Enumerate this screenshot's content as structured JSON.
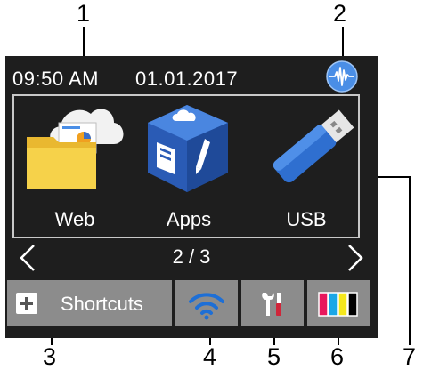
{
  "callouts": {
    "c1": "1",
    "c2": "2",
    "c3": "3",
    "c4": "4",
    "c5": "5",
    "c6": "6",
    "c7": "7"
  },
  "status": {
    "time": "09:50  AM",
    "date": "01.01.2017",
    "wave_icon": "wave-icon"
  },
  "apps": [
    {
      "label": "Web",
      "icon": "web-folder-cloud-icon"
    },
    {
      "label": "Apps",
      "icon": "apps-cube-icon"
    },
    {
      "label": "USB",
      "icon": "usb-drive-icon"
    }
  ],
  "navigation": {
    "page": "2 / 3",
    "prev_icon": "chevron-left-icon",
    "next_icon": "chevron-right-icon"
  },
  "bottom_bar": {
    "shortcuts_label": "Shortcuts",
    "shortcuts_icon": "plus-icon",
    "wifi_icon": "wifi-icon",
    "tools_icon": "tools-icon",
    "toner_icon": "toner-icon"
  },
  "colors": {
    "screen_bg": "#1e1e1e",
    "button_bg": "#8c8c8c",
    "accent_blue": "#3a6fc9",
    "toner": [
      "#e8175d",
      "#1ba7e6",
      "#f5e71c",
      "#000000"
    ]
  }
}
